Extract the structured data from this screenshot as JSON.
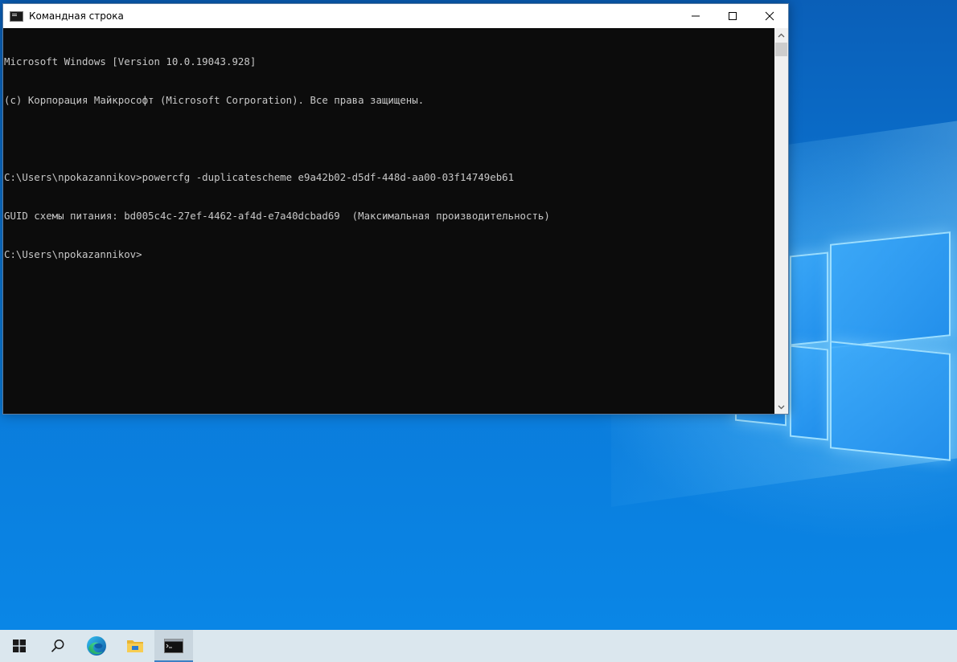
{
  "window": {
    "title": "Командная строка",
    "buttons": {
      "minimize": "minimize",
      "maximize": "maximize",
      "close": "close"
    }
  },
  "console": {
    "lines": [
      "Microsoft Windows [Version 10.0.19043.928]",
      "(c) Корпорация Майкрософт (Microsoft Corporation). Все права защищены.",
      "",
      "C:\\Users\\npokazannikov>powercfg -duplicatescheme e9a42b02-d5df-448d-aa00-03f14749eb61",
      "GUID схемы питания: bd005c4c-27ef-4462-af4d-e7a40dcbad69  (Максимальная производительность)",
      "C:\\Users\\npokazannikov>"
    ]
  },
  "taskbar": {
    "items": [
      "windows-start-icon",
      "search-icon",
      "edge-browser-icon",
      "file-explorer-icon",
      "command-prompt-icon"
    ],
    "active": "command-prompt-icon"
  },
  "colors": {
    "console_bg": "#0c0c0c",
    "console_text": "#c8c8c8",
    "desktop_blue": "#0a78d8",
    "taskbar_bg": "#dbe7ee"
  }
}
